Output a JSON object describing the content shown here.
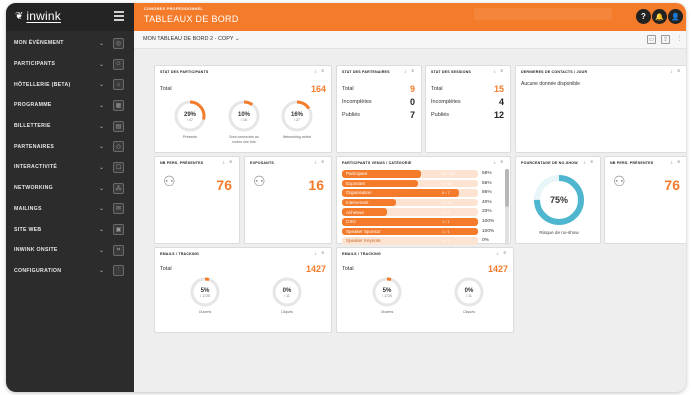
{
  "app": {
    "logo": "inwink",
    "logo_mark": "❦"
  },
  "header": {
    "supertitle": "CONGRES PROFESSIONNEL",
    "title": "TABLEAUX DE BORD",
    "help": "?",
    "bell": "🔔",
    "user": "👤"
  },
  "subbar": {
    "dashboard_name": "MON TABLEAU DE BORD 2 - COPY ⌄",
    "tool_icons": [
      "image-icon",
      "share-icon",
      "settings-icon"
    ]
  },
  "sidebar": {
    "items": [
      {
        "label": "MON ÉVÉNEMENT",
        "icon": "event-icon",
        "glyph": "◎"
      },
      {
        "label": "PARTICIPANTS",
        "icon": "participants-icon",
        "glyph": "☺"
      },
      {
        "label": "HÔTELLERIE (BETA)",
        "icon": "hotel-icon",
        "glyph": "⌂"
      },
      {
        "label": "PROGRAMME",
        "icon": "calendar-icon",
        "glyph": "▦"
      },
      {
        "label": "BILLETTERIE",
        "icon": "ticket-icon",
        "glyph": "▤"
      },
      {
        "label": "PARTENAIRES",
        "icon": "partners-icon",
        "glyph": "◇"
      },
      {
        "label": "INTERACTIVITÉ",
        "icon": "interactivity-icon",
        "glyph": "☐"
      },
      {
        "label": "NETWORKING",
        "icon": "network-icon",
        "glyph": "⁂"
      },
      {
        "label": "MAILINGS",
        "icon": "mail-icon",
        "glyph": "✉"
      },
      {
        "label": "SITE WEB",
        "icon": "web-icon",
        "glyph": "▣"
      },
      {
        "label": "INWINK ONSITE",
        "icon": "onsite-icon",
        "glyph": "⌗"
      },
      {
        "label": "CONFIGURATION",
        "icon": "config-icon",
        "glyph": "⫶"
      }
    ],
    "chevron": "⌄"
  },
  "cards": {
    "stat_participants": {
      "title": "STAT DES PARTICIPANTS",
      "total_label": "Total",
      "total_value": "164",
      "circles": [
        {
          "pct": "29%",
          "sub": "/ 47",
          "fraction": 0.29,
          "caption": "Présents"
        },
        {
          "pct": "10%",
          "sub": "/ 16",
          "fraction": 0.1,
          "caption": "Sont connectés au moins une fois"
        },
        {
          "pct": "16%",
          "sub": "/ 27",
          "fraction": 0.16,
          "caption": "Networking activé"
        }
      ]
    },
    "stat_partners": {
      "title": "STAT DES PARTENAIRES",
      "rows": [
        {
          "label": "Total",
          "value": "9",
          "highlight": true
        },
        {
          "label": "Incomplètes",
          "value": "0",
          "highlight": false
        },
        {
          "label": "Publiés",
          "value": "7",
          "highlight": false
        }
      ]
    },
    "stat_sessions": {
      "title": "STAT DES SESSIONS",
      "rows": [
        {
          "label": "Total",
          "value": "15",
          "highlight": true
        },
        {
          "label": "Incomplètes",
          "value": "4",
          "highlight": false
        },
        {
          "label": "Publiés",
          "value": "12",
          "highlight": false
        }
      ]
    },
    "last_contacts": {
      "title": "DERNIERES DE CONTACTS / JOUR",
      "message": "Aucune donnée disponible"
    },
    "present_people": {
      "title": "NB PERS. PRÉSENTES",
      "value": "76"
    },
    "exhibitors": {
      "title": "EXPOSANTS",
      "value": "16"
    },
    "participants_by_category": {
      "title": "PARTICIPANTS VENUS / CATÉGORIE",
      "bars": [
        {
          "name": "Participant",
          "count": "26 / 45",
          "fraction": 0.58,
          "pct": "58%"
        },
        {
          "name": "Exposant",
          "count": "9 / 16",
          "fraction": 0.56,
          "pct": "56%"
        },
        {
          "name": "Organisation",
          "count": "6 / 7",
          "fraction": 0.86,
          "pct": "86%"
        },
        {
          "name": "Intervenant",
          "count": "4 / 10",
          "fraction": 0.4,
          "pct": "40%"
        },
        {
          "name": "Acheteur",
          "count": "3 / 9",
          "fraction": 0.33,
          "pct": "33%"
        },
        {
          "name": "CXO",
          "count": "1 / 1",
          "fraction": 1.0,
          "pct": "100%"
        },
        {
          "name": "Speaker Sponsor",
          "count": "1 / 1",
          "fraction": 1.0,
          "pct": "100%"
        },
        {
          "name": "Speaker Keynote",
          "count": "0 / 1",
          "fraction": 0.0,
          "pct": "0%"
        }
      ]
    },
    "no_show": {
      "title": "POURCENTAGE DE NO-SHOW",
      "pct": "75%",
      "fraction": 0.75,
      "caption": "Risque de no-show"
    },
    "present_people_2": {
      "title": "NB PERS. PRÉSENTES",
      "value": "76"
    },
    "emails_1": {
      "title": "EMAILS / TRACKING",
      "total_label": "Total",
      "total_value": "1427",
      "circles": [
        {
          "pct": "5%",
          "sub": "/ 1725",
          "fraction": 0.05,
          "caption": "Ouverts"
        },
        {
          "pct": "0%",
          "sub": "/ 11",
          "fraction": 0.0,
          "caption": "Cliqués"
        }
      ]
    },
    "emails_2": {
      "title": "EMAILS / TRACKING",
      "total_label": "Total",
      "total_value": "1427",
      "circles": [
        {
          "pct": "5%",
          "sub": "/ 1725",
          "fraction": 0.05,
          "caption": "Ouverts"
        },
        {
          "pct": "0%",
          "sub": "/ 11",
          "fraction": 0.0,
          "caption": "Cliqués"
        }
      ]
    },
    "card_tools": "⤓ ⊞"
  },
  "colors": {
    "accent": "#f47b2a",
    "teal": "#4fb6cf",
    "sidebar": "#2c2c2c",
    "ring_bg": "#e6e6e6"
  }
}
